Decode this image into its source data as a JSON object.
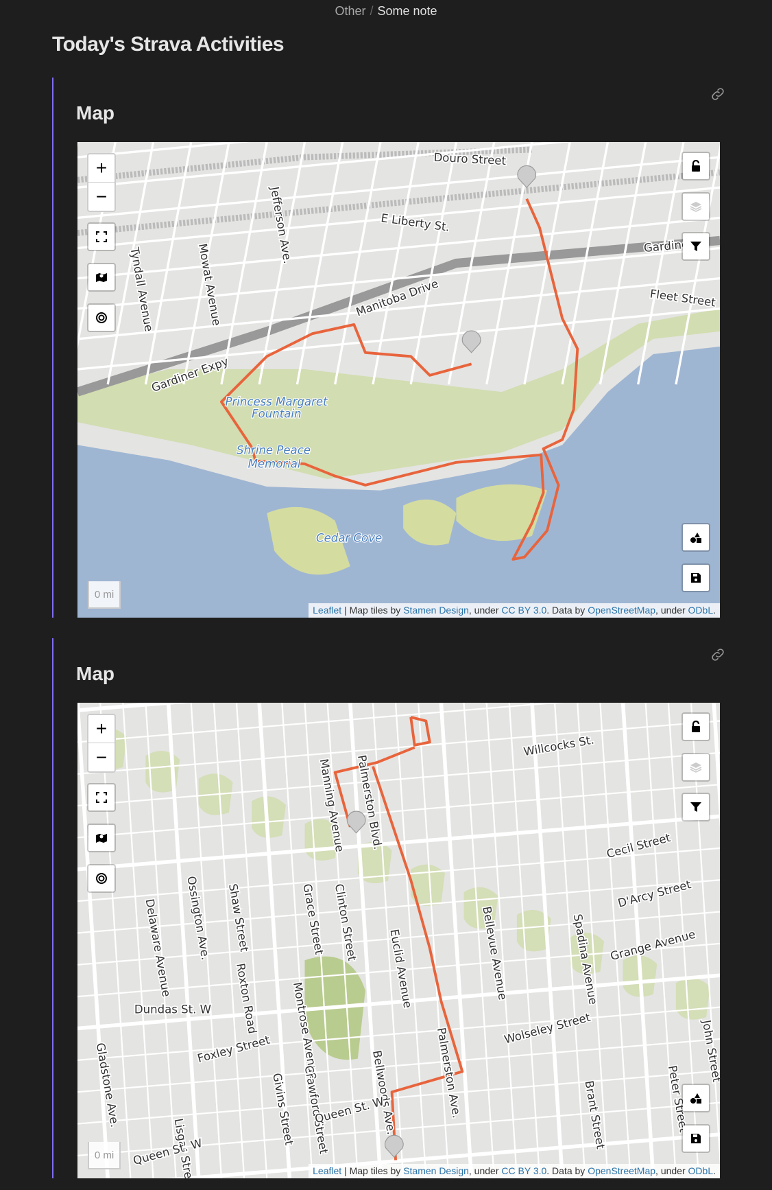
{
  "breadcrumb": {
    "parent": "Other",
    "current": "Some note"
  },
  "title": "Today's Strava Activities",
  "colors": {
    "accent": "#7f6df2",
    "route": "#e8643c",
    "water": "#9fb6d3",
    "park": "#cddba5"
  },
  "maps": [
    {
      "heading": "Map",
      "scale": "0 mi",
      "labels": {
        "douro": "Douro Street",
        "liberty": "E Liberty St.",
        "jefferson": "Jefferson Ave.",
        "mowat": "Mowat Avenue",
        "tyndall": "Tyndall Avenue",
        "manitoba": "Manitoba Drive",
        "gardiner": "Gardiner Expy",
        "gardiner2": "Gardiner",
        "fleet": "Fleet Street",
        "pmf": "Princess Margaret",
        "pmf2": "Fountain",
        "shrine": "Shrine Peace",
        "shrine2": "Memorial",
        "cedar": "Cedar Cove"
      }
    },
    {
      "heading": "Map",
      "scale": "0 mi",
      "labels": {
        "manning": "Manning Avenue",
        "palmerston": "Palmerston Blvd.",
        "willcocks": "Willcocks St.",
        "delaware": "Delaware Avenue",
        "ossington": "Ossington Ave.",
        "shaw": "Shaw Street",
        "grace": "Grace Street",
        "clinton": "Clinton Street",
        "euclid": "Euclid Avenue",
        "bellevue": "Bellevue Avenue",
        "spadina": "Spadina Avenue",
        "cecil": "Cecil Street",
        "darcy": "D'Arcy Street",
        "grange": "Grange Avenue",
        "montrose": "Montrose Avenue",
        "roxton": "Roxton Road",
        "palmerston2": "Palmerston Ave.",
        "bellwoods": "Bellwoods Ave.",
        "crawford": "Crawford Street",
        "dundas": "Dundas St. W",
        "gladstone": "Gladstone Ave.",
        "foxley": "Foxley Street",
        "givins": "Givins Street",
        "lisgar": "Lisgar Street",
        "queen": "Queen St. W",
        "queen2": "Queen St. W",
        "wolseley": "Wolseley Street",
        "brant": "Brant Street",
        "peter": "Peter Street",
        "john": "John Street"
      }
    }
  ],
  "attribution": {
    "leaflet": "Leaflet",
    "sep": " | Map tiles by ",
    "stamen": "Stamen Design",
    "under1": ", under ",
    "cc": "CC BY 3.0",
    "data": ". Data by ",
    "osm": "OpenStreetMap",
    "under2": ", under ",
    "odbl": "ODbL",
    "end": "."
  },
  "icons": {
    "zoom_in": "plus-icon",
    "zoom_out": "minus-icon",
    "fullscreen": "fullscreen-icon",
    "map": "map-icon",
    "locate": "target-icon",
    "lock": "unlock-icon",
    "layers": "layers-icon",
    "filter": "filter-icon",
    "shapes": "shapes-icon",
    "save": "save-icon",
    "anchor": "link-icon",
    "marker": "map-marker-icon"
  },
  "controls": {
    "zoom_in": "+",
    "zoom_out": "−"
  }
}
